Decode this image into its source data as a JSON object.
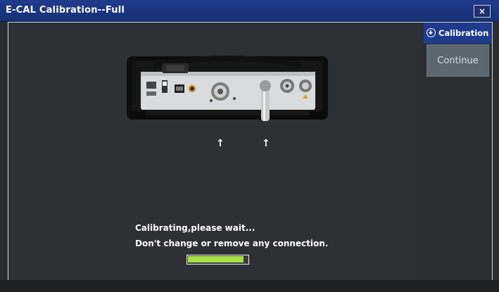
{
  "window": {
    "title": "E-CAL Calibration--Full",
    "close_label": "×"
  },
  "sidebar": {
    "header_label": "Calibration",
    "header_icon": "download-circle-icon",
    "continue_label": "Continue"
  },
  "main": {
    "arrow_glyph": "↑",
    "status_line1": "Calibrating,please wait...",
    "status_line2": "Don't change or remove any connection.",
    "progress": 0.93
  },
  "colors": {
    "titlebar": "#1f3b8c",
    "progress_fill": "#a8e043",
    "continue_bg": "#5c6770"
  }
}
